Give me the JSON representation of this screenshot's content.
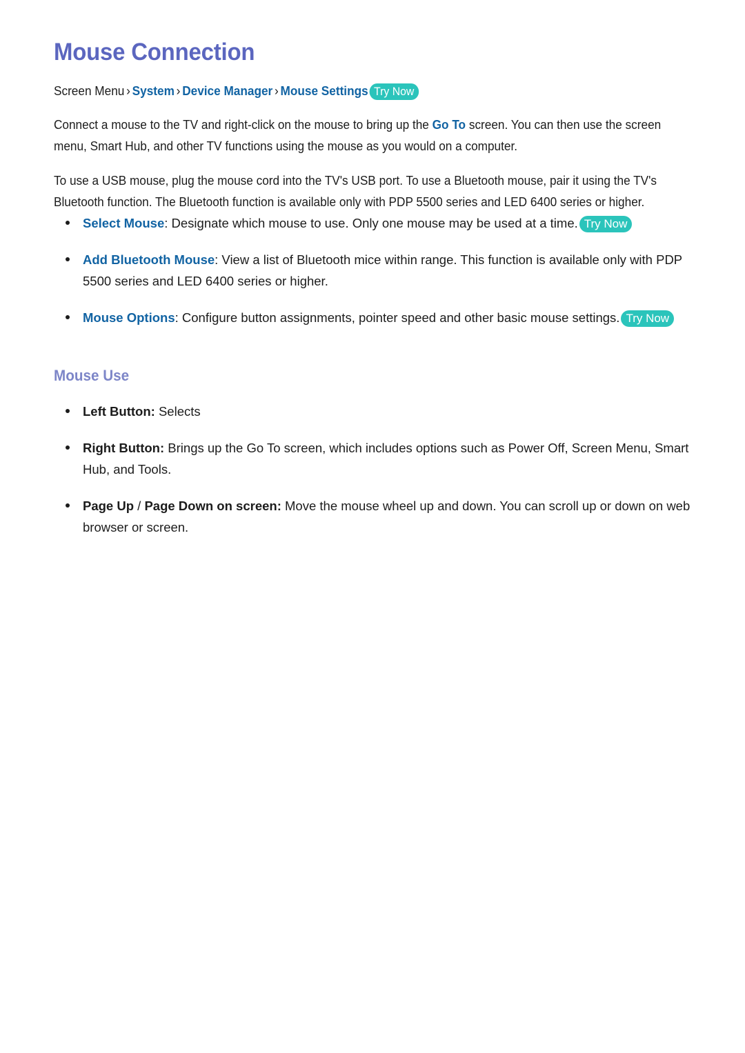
{
  "document": {
    "title": "Mouse Connection",
    "colors": {
      "title": "#5b66bf",
      "section_heading": "#7d86c8",
      "link_blue": "#1163a3",
      "badge_teal": "#2bc4bb",
      "body_text": "#1c1c1c",
      "page_background": "#ffffff"
    }
  },
  "breadcrumb": {
    "root": "Screen Menu",
    "separator": "›",
    "items": [
      "System",
      "Device Manager",
      "Mouse Settings"
    ],
    "badge": "Try Now"
  },
  "paragraphs": [
    {
      "id": "intro",
      "segments": [
        {
          "type": "text",
          "value": "Connect a mouse to the TV and right-click on the mouse to bring up the "
        },
        {
          "type": "keyword",
          "value": "Go To"
        },
        {
          "type": "text",
          "value": " screen. You can then use the screen menu, Smart Hub, and other TV functions using the mouse as you would on a computer."
        }
      ]
    },
    {
      "id": "connection-methods",
      "segments": [
        {
          "type": "text",
          "value": "To use a USB mouse, plug the mouse cord into the TV's USB port. To use a Bluetooth mouse, pair it using the TV's Bluetooth function. The Bluetooth function is available only with PDP 5500 series and LED 6400 series or higher."
        }
      ]
    }
  ],
  "settings_list": [
    {
      "label": "Select Mouse",
      "colon": ":",
      "description": " Designate which mouse to use. Only one mouse may be used at a time.",
      "badge": "Try Now",
      "label_style": "link"
    },
    {
      "label": "Add Bluetooth Mouse",
      "colon": ":",
      "description": " View a list of Bluetooth mice within range. This function is available only with PDP 5500 series and LED 6400 series or higher.",
      "badge": null,
      "label_style": "link"
    },
    {
      "label": "Mouse Options",
      "colon": ":",
      "description": " Configure button assignments, pointer speed and other basic mouse settings.",
      "badge": "Try Now",
      "label_style": "link"
    }
  ],
  "mouse_use": {
    "heading": "Mouse Use",
    "items": [
      {
        "label": "Left Button",
        "colon": ":",
        "description": " Selects",
        "label_style": "bold"
      },
      {
        "label": "Right Button",
        "colon": ":",
        "description": " Brings up the Go To screen, which includes options such as Power Off, Screen Menu, Smart Hub, and Tools.",
        "label_style": "bold"
      },
      {
        "label_part_1": "Page Up",
        "label_slash": " / ",
        "label_part_2": "Page Down on screen",
        "colon": ":",
        "description": " Move the mouse wheel up and down. You can scroll up or down on web browser or screen.",
        "label_style": "bold-split"
      }
    ]
  }
}
